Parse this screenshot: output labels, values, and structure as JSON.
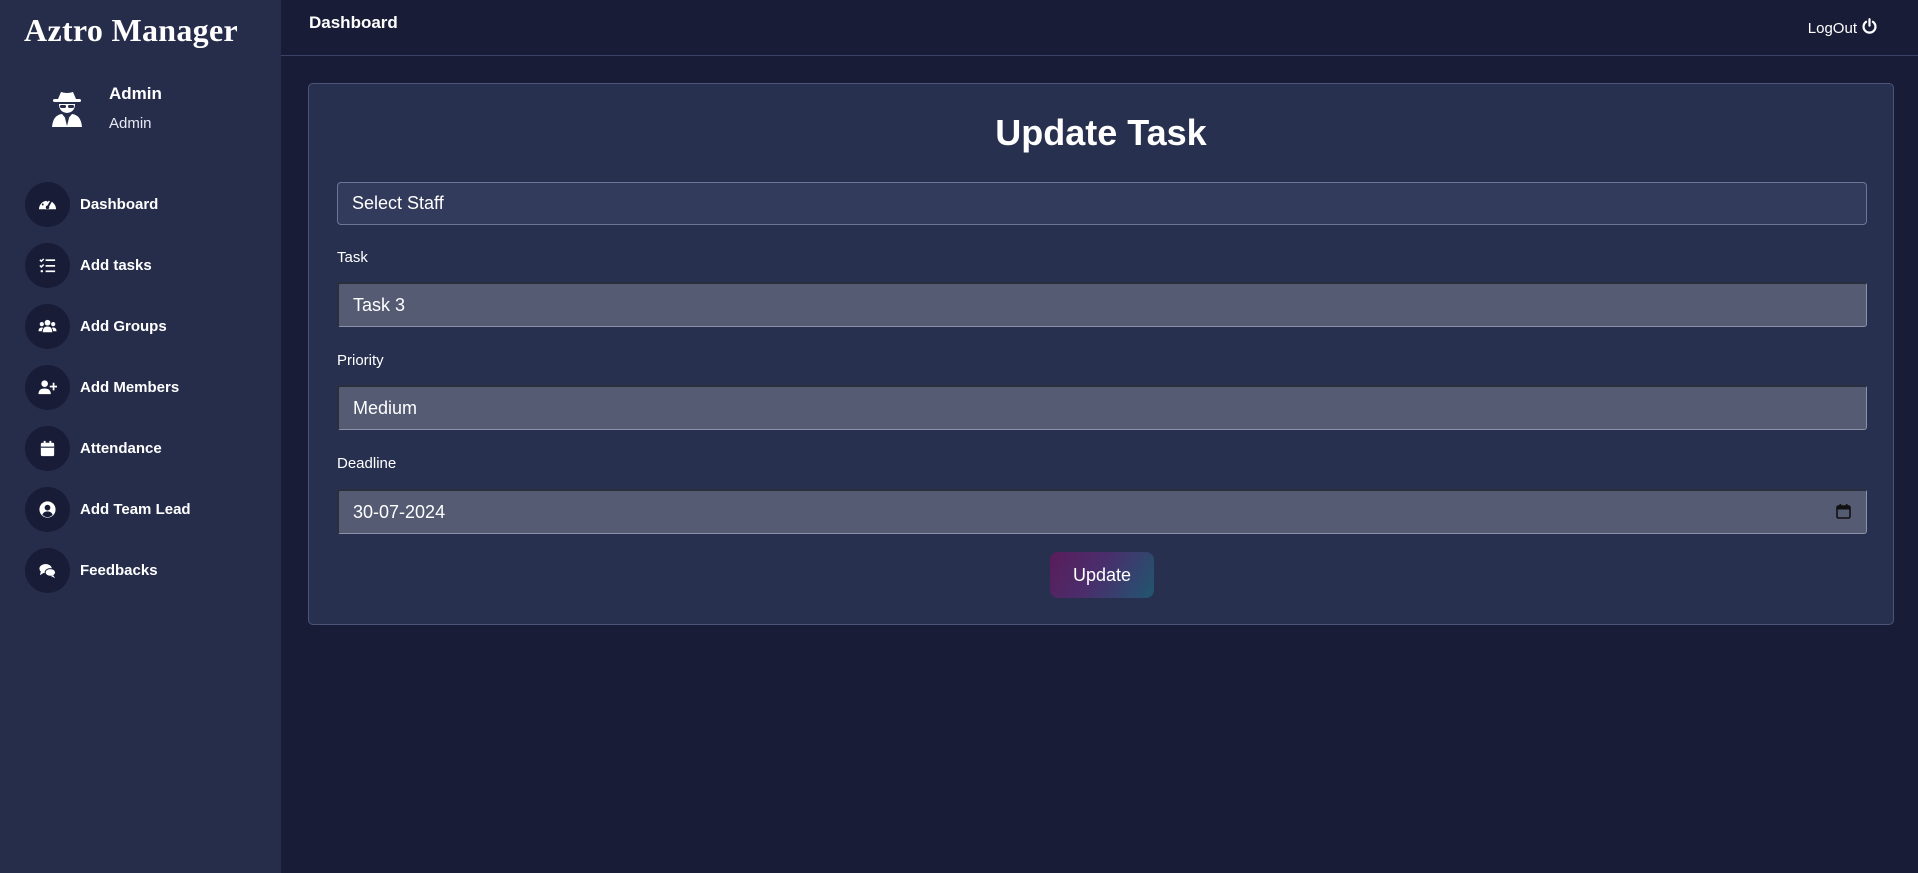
{
  "app": {
    "brand": "Aztro Manager"
  },
  "profile": {
    "name": "Admin",
    "role": "Admin",
    "avatar_icon": "user-secret-icon"
  },
  "sidebar": {
    "items": [
      {
        "label": "Dashboard",
        "icon": "gauge-icon"
      },
      {
        "label": "Add tasks",
        "icon": "list-check-icon"
      },
      {
        "label": "Add Groups",
        "icon": "users-icon"
      },
      {
        "label": "Add Members",
        "icon": "user-plus-icon"
      },
      {
        "label": "Attendance",
        "icon": "calendar-icon"
      },
      {
        "label": "Add Team Lead",
        "icon": "user-circle-icon"
      },
      {
        "label": "Feedbacks",
        "icon": "comments-icon"
      }
    ]
  },
  "header": {
    "title": "Dashboard",
    "logout_label": "LogOut",
    "logout_icon": "power-icon"
  },
  "form": {
    "title": "Update Task",
    "staff_select": {
      "selected": "Select Staff"
    },
    "task": {
      "label": "Task",
      "value": "Task 3"
    },
    "priority": {
      "label": "Priority",
      "value": "Medium"
    },
    "deadline": {
      "label": "Deadline",
      "value": "30-07-2024",
      "icon": "calendar-icon"
    },
    "submit_label": "Update"
  },
  "colors": {
    "page_bg": "#181c37",
    "sidebar_bg": "#262d4b",
    "card_bg": "#28304f",
    "input_bg": "#545b73",
    "button_gradient_start": "#5a1c5a",
    "button_gradient_end": "#20566f"
  }
}
